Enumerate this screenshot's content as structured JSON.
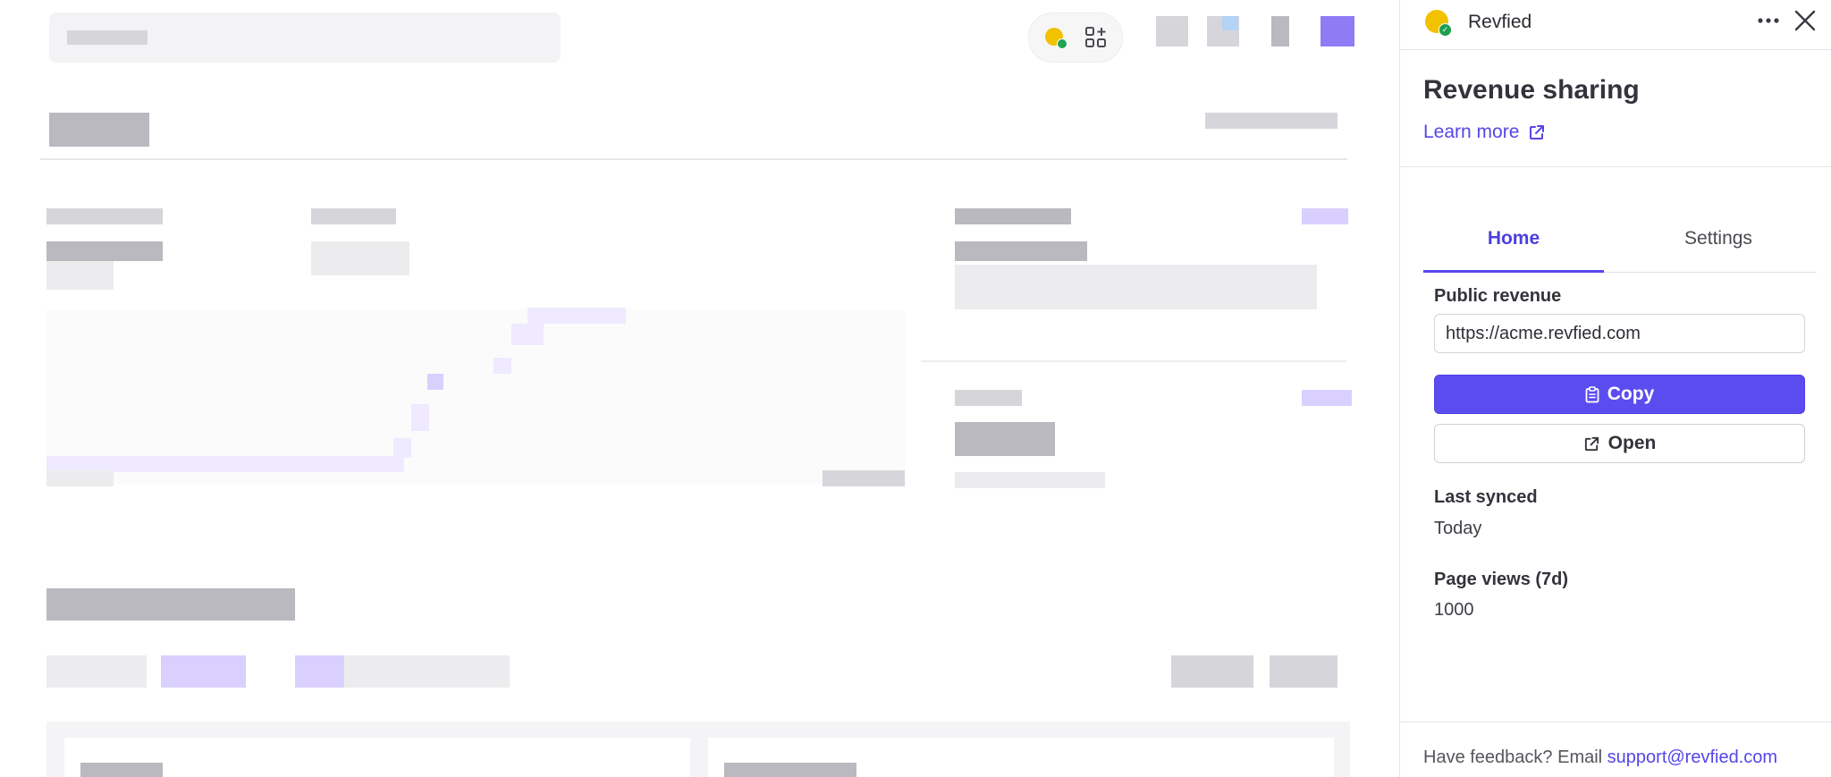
{
  "panel": {
    "app_name": "Revfied",
    "title": "Revenue sharing",
    "learn_more": "Learn more",
    "tabs": [
      {
        "label": "Home",
        "active": true
      },
      {
        "label": "Settings",
        "active": false
      }
    ],
    "public_revenue": {
      "label": "Public revenue",
      "url": "https://acme.revfied.com"
    },
    "buttons": {
      "copy": "Copy",
      "open": "Open"
    },
    "last_synced": {
      "label": "Last synced",
      "value": "Today"
    },
    "page_views": {
      "label": "Page views (7d)",
      "value": "1000"
    },
    "footer": {
      "text": "Have feedback? Email",
      "email": "support@revfied.com"
    }
  },
  "icons": {
    "logo": "revfied-coin-icon",
    "more": "more-horizontal-icon",
    "close": "close-icon",
    "external": "external-link-icon",
    "clipboard": "clipboard-icon",
    "apps": "add-apps-icon"
  },
  "colors": {
    "accent": "#5b4cf0",
    "link": "#5646e8",
    "coin": "#f2c200",
    "check": "#1f9e50"
  }
}
